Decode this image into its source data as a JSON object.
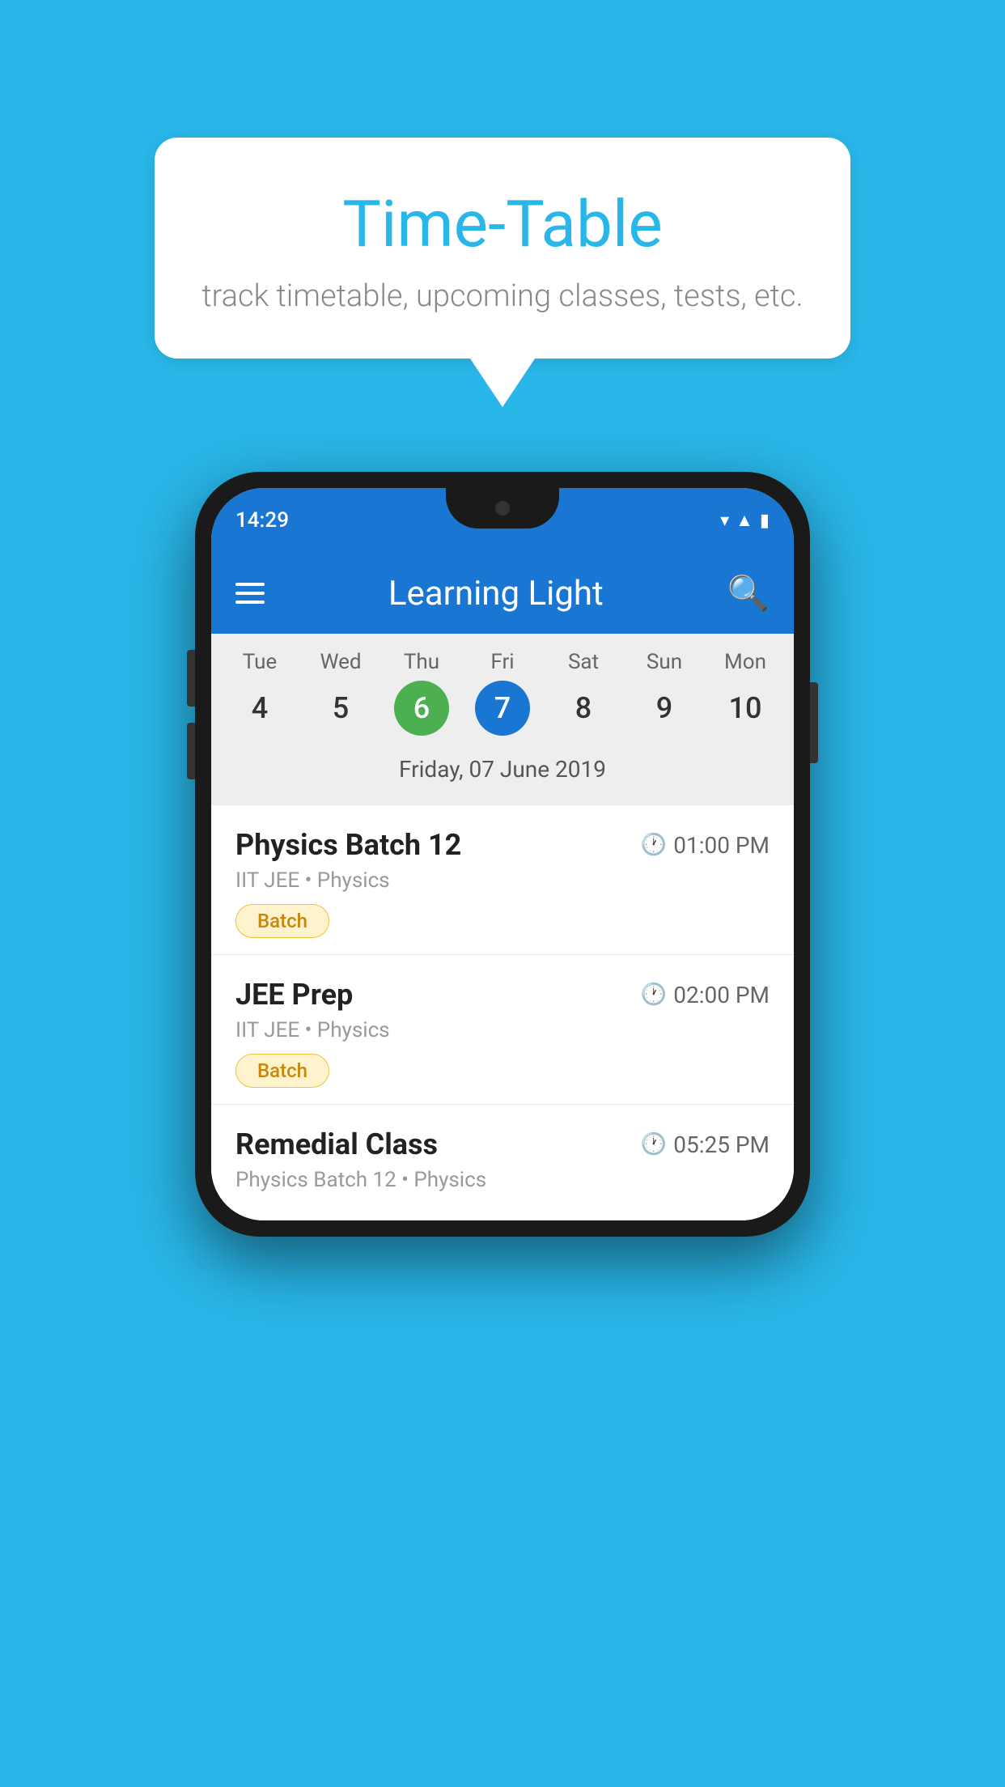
{
  "page": {
    "background_color": "#29B6E8"
  },
  "speech_bubble": {
    "title": "Time-Table",
    "subtitle": "track timetable, upcoming classes, tests, etc."
  },
  "phone": {
    "status_time": "14:29",
    "app_title": "Learning Light",
    "calendar": {
      "days": [
        {
          "label": "Tue",
          "number": "4",
          "state": "normal"
        },
        {
          "label": "Wed",
          "number": "5",
          "state": "normal"
        },
        {
          "label": "Thu",
          "number": "6",
          "state": "today"
        },
        {
          "label": "Fri",
          "number": "7",
          "state": "selected"
        },
        {
          "label": "Sat",
          "number": "8",
          "state": "normal"
        },
        {
          "label": "Sun",
          "number": "9",
          "state": "normal"
        },
        {
          "label": "Mon",
          "number": "10",
          "state": "normal"
        }
      ],
      "selected_date": "Friday, 07 June 2019"
    },
    "schedule": [
      {
        "title": "Physics Batch 12",
        "time": "01:00 PM",
        "subtitle": "IIT JEE • Physics",
        "badge": "Batch"
      },
      {
        "title": "JEE Prep",
        "time": "02:00 PM",
        "subtitle": "IIT JEE • Physics",
        "badge": "Batch"
      },
      {
        "title": "Remedial Class",
        "time": "05:25 PM",
        "subtitle": "Physics Batch 12 • Physics",
        "badge": null
      }
    ]
  }
}
